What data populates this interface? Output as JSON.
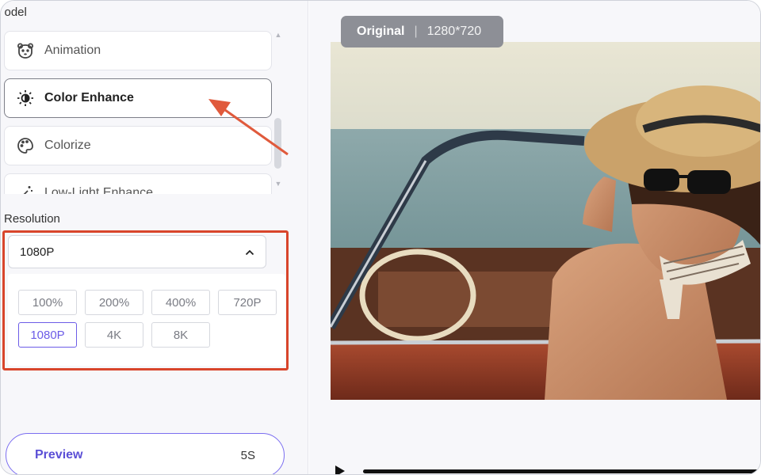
{
  "model_section": {
    "title": "Model",
    "items": [
      {
        "label": "Animation",
        "icon": "bear-face-icon"
      },
      {
        "label": "Color Enhance",
        "icon": "sun-half-icon",
        "selected": true
      },
      {
        "label": "Colorize",
        "icon": "palette-icon"
      },
      {
        "label": "Low-Light Enhance",
        "icon": "magic-wand-icon"
      }
    ]
  },
  "resolution_section": {
    "title": "Resolution",
    "selected": "1080P",
    "options": [
      "100%",
      "200%",
      "400%",
      "720P",
      "1080P",
      "4K",
      "8K"
    ],
    "active_option": "1080P"
  },
  "preview_button": {
    "label": "Preview",
    "duration": "5S"
  },
  "viewer": {
    "badge_label": "Original",
    "badge_separator": "|",
    "badge_resolution": "1280*720"
  },
  "colors": {
    "accent": "#6c5ce7",
    "highlight_box": "#d8452b",
    "arrow": "#e05a3c"
  }
}
